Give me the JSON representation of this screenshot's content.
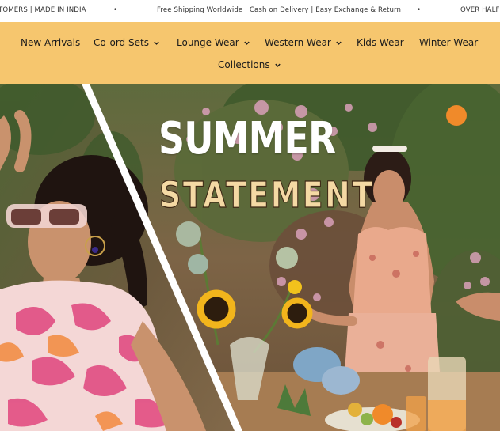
{
  "announcement": {
    "messages": [
      "TOMERS | MADE IN INDIA",
      "Free Shipping Worldwide | Cash on Delivery | Easy Exchange & Return",
      "OVER HALF A"
    ],
    "separator": "•"
  },
  "nav": {
    "items": [
      {
        "label": "New Arrivals",
        "has_dropdown": false
      },
      {
        "label": "Co-ord Sets",
        "has_dropdown": true
      },
      {
        "label": "Lounge Wear",
        "has_dropdown": true
      },
      {
        "label": "Western Wear",
        "has_dropdown": true
      },
      {
        "label": "Kids Wear",
        "has_dropdown": false
      },
      {
        "label": "Winter Wear",
        "has_dropdown": false
      },
      {
        "label": "Collections",
        "has_dropdown": true
      }
    ],
    "background_color": "#f6c66e"
  },
  "hero": {
    "title_line1": "SUMMER",
    "title_line2": "STATEMENT",
    "title_color": "#ffffff",
    "outline_text_color": "#f4d9a4"
  },
  "icons": {
    "dropdown": "chevron-down-icon"
  }
}
